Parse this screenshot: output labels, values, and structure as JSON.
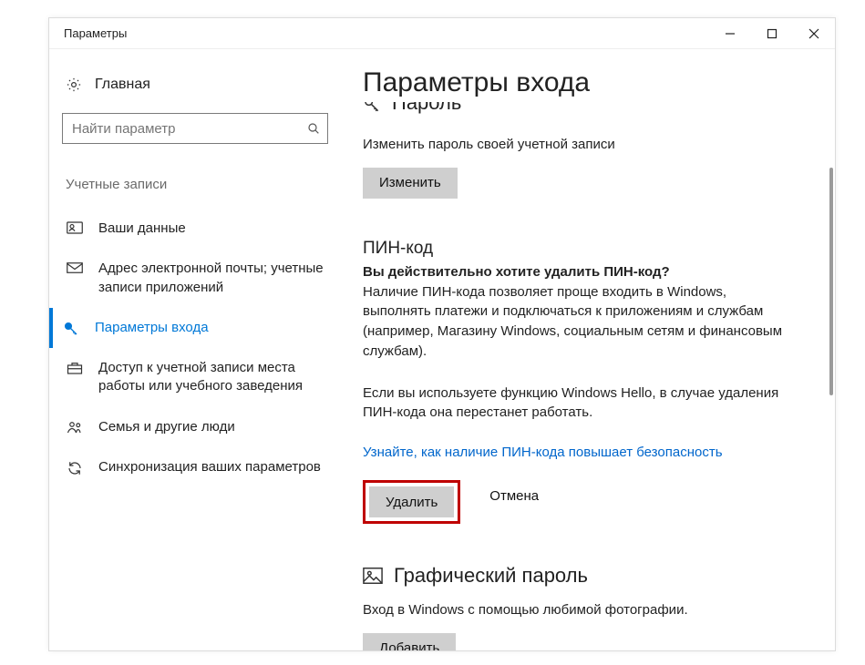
{
  "window": {
    "title": "Параметры"
  },
  "sidebar": {
    "home_label": "Главная",
    "search_placeholder": "Найти параметр",
    "category_label": "Учетные записи",
    "items": [
      {
        "label": "Ваши данные"
      },
      {
        "label": "Адрес электронной почты; учетные записи приложений"
      },
      {
        "label": "Параметры входа"
      },
      {
        "label": "Доступ к учетной записи места работы или учебного заведения"
      },
      {
        "label": "Семья и другие люди"
      },
      {
        "label": "Синхронизация ваших параметров"
      }
    ]
  },
  "main": {
    "page_title": "Параметры входа",
    "password": {
      "partial_heading": "Пароль",
      "desc": "Изменить пароль своей учетной записи",
      "change_label": "Изменить"
    },
    "pin": {
      "heading": "ПИН-код",
      "confirm_q": "Вы действительно хотите удалить ПИН-код?",
      "desc": "Наличие ПИН-кода позволяет проще входить в Windows, выполнять платежи и подключаться к приложениям и службам (например, Магазину Windows, социальным сетям и финансовым службам).",
      "hello_note": "Если вы используете функцию Windows Hello, в случае удаления ПИН-кода она перестанет работать.",
      "link": "Узнайте, как наличие ПИН-кода повышает безопасность",
      "delete_label": "Удалить",
      "cancel_label": "Отмена"
    },
    "picture": {
      "heading": "Графический пароль",
      "desc": "Вход в Windows с помощью любимой фотографии.",
      "add_label": "Добавить"
    }
  }
}
